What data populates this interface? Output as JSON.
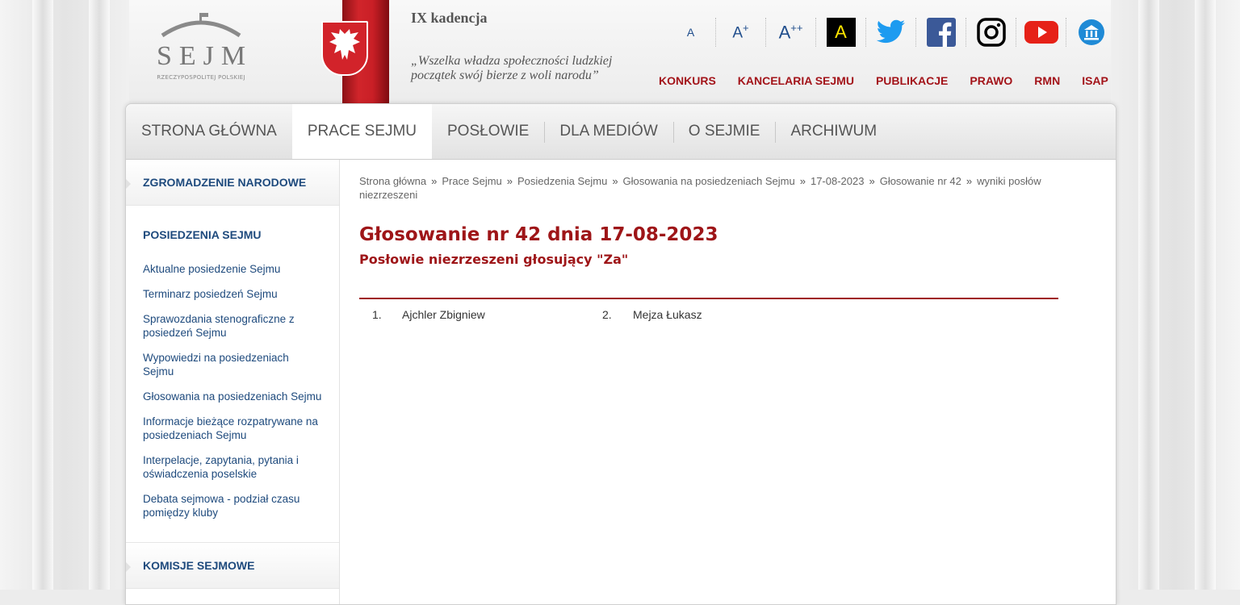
{
  "header": {
    "logo_word": "SEJM",
    "logo_sub": "RZECZYPOSPOLITEJ POLSKIEJ",
    "kadencja": "IX kadencja",
    "motto_line1": "„Wszelka władza społeczności ludzkiej",
    "motto_line2": "początek swój bierze z woli narodu”"
  },
  "toolbar": {
    "font_small": "A",
    "font_medium": "A",
    "font_medium_sup": "+",
    "font_large": "A",
    "font_large_sup": "++",
    "contrast": "A",
    "social": [
      "twitter-icon",
      "facebook-icon",
      "instagram-icon",
      "youtube-icon",
      "institution-icon"
    ]
  },
  "topnav": [
    "KONKURS",
    "KANCELARIA SEJMU",
    "PUBLIKACJE",
    "PRAWO",
    "RMN",
    "ISAP"
  ],
  "mainnav": [
    "STRONA GŁÓWNA",
    "PRACE SEJMU",
    "POSŁOWIE",
    "DLA MEDIÓW",
    "O SEJMIE",
    "ARCHIWUM"
  ],
  "sidebar": {
    "head1": "ZGROMADZENIE NARODOWE",
    "head2": "POSIEDZENIA SEJMU",
    "links": [
      "Aktualne posiedzenie Sejmu",
      "Terminarz posiedzeń Sejmu",
      "Sprawozdania stenograficzne z posiedzeń Sejmu",
      "Wypowiedzi na posiedzeniach Sejmu",
      "Głosowania na posiedzeniach Sejmu",
      "Informacje bieżące rozpatrywane na posiedzeniach Sejmu",
      "Interpelacje, zapytania, pytania i oświadczenia poselskie",
      "Debata sejmowa - podział czasu pomiędzy kluby"
    ],
    "head3": "KOMISJE SEJMOWE"
  },
  "breadcrumb": {
    "items": [
      "Strona główna",
      "Prace Sejmu",
      "Posiedzenia Sejmu",
      "Głosowania na posiedzeniach Sejmu",
      "17-08-2023",
      "Głosowanie nr 42"
    ],
    "last": "wyniki posłów niezrzeszeni",
    "separator": "»"
  },
  "main": {
    "title": "Głosowanie nr 42 dnia 17-08-2023",
    "subtitle": "Posłowie niezrzeszeni głosujący \"Za\"",
    "votes": [
      {
        "num": "1.",
        "name": "Ajchler Zbigniew"
      },
      {
        "num": "2.",
        "name": "Mejza Łukasz"
      }
    ]
  },
  "colors": {
    "accent_red": "#9e1518",
    "link_blue": "#1e4a7d",
    "nav_gray": "#555555"
  }
}
